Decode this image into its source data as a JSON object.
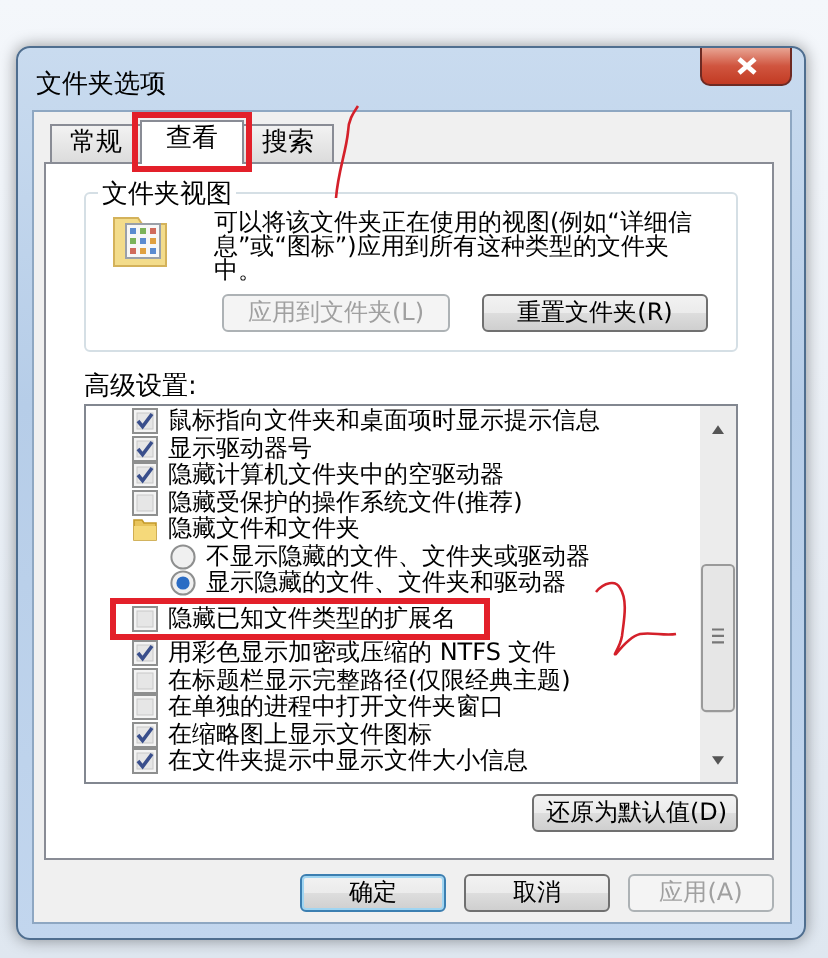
{
  "window": {
    "title": "文件夹选项"
  },
  "tabs": [
    {
      "label": "常规",
      "selected": false,
      "highlighted": false
    },
    {
      "label": "查看",
      "selected": true,
      "highlighted": true
    },
    {
      "label": "搜索",
      "selected": false,
      "highlighted": false
    }
  ],
  "folder_views": {
    "title": "文件夹视图",
    "description": "可以将该文件夹正在使用的视图(例如“详细信息”或“图标”)应用到所有这种类型的文件夹中。",
    "buttons": [
      {
        "label": "应用到文件夹(L)",
        "disabled": true
      },
      {
        "label": "重置文件夹(R)",
        "disabled": false
      }
    ]
  },
  "advanced": {
    "title": "高级设置:",
    "items": [
      {
        "kind": "checkbox",
        "label": "鼠标指向文件夹和桌面项时显示提示信息",
        "checked": true,
        "highlighted": false
      },
      {
        "kind": "checkbox",
        "label": "显示驱动器号",
        "checked": true,
        "highlighted": false
      },
      {
        "kind": "checkbox",
        "label": "隐藏计算机文件夹中的空驱动器",
        "checked": true,
        "highlighted": false
      },
      {
        "kind": "checkbox",
        "label": "隐藏受保护的操作系统文件(推荐)",
        "checked": false,
        "highlighted": false
      },
      {
        "kind": "folder",
        "label": "隐藏文件和文件夹",
        "highlighted": false,
        "children": [
          {
            "kind": "radio",
            "label": "不显示隐藏的文件、文件夹或驱动器",
            "selected": false
          },
          {
            "kind": "radio",
            "label": "显示隐藏的文件、文件夹和驱动器",
            "selected": true
          }
        ]
      },
      {
        "kind": "checkbox",
        "label": "隐藏已知文件类型的扩展名",
        "checked": false,
        "highlighted": true
      },
      {
        "kind": "checkbox",
        "label": "用彩色显示加密或压缩的 NTFS 文件",
        "checked": true,
        "highlighted": false
      },
      {
        "kind": "checkbox",
        "label": "在标题栏显示完整路径(仅限经典主题)",
        "checked": false,
        "highlighted": false
      },
      {
        "kind": "checkbox",
        "label": "在单独的进程中打开文件夹窗口",
        "checked": false,
        "highlighted": false
      },
      {
        "kind": "checkbox",
        "label": "在缩略图上显示文件图标",
        "checked": true,
        "highlighted": false
      },
      {
        "kind": "checkbox",
        "label": "在文件夹提示中显示文件大小信息",
        "checked": true,
        "highlighted": false
      }
    ]
  },
  "restore_button": "还原为默认值(D)",
  "buttons": [
    {
      "label": "确定",
      "disabled": false
    },
    {
      "label": "取消",
      "disabled": false
    },
    {
      "label": "应用(A)",
      "disabled": true
    }
  ],
  "annotations": [
    {
      "kind": "line"
    },
    {
      "kind": "brace"
    }
  ]
}
